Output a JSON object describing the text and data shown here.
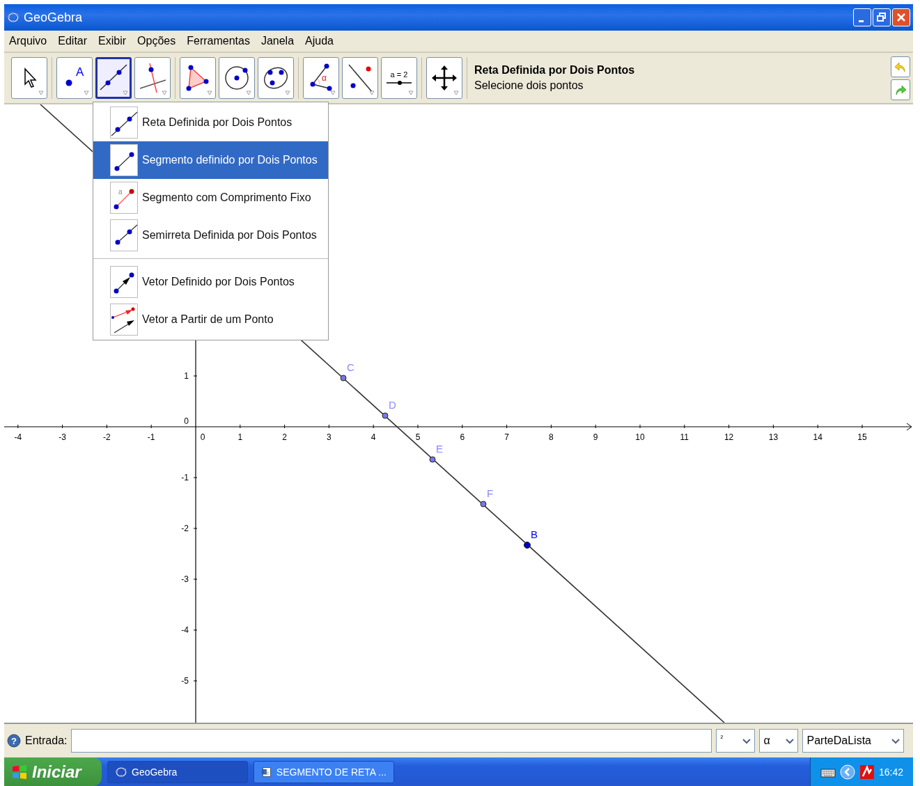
{
  "window": {
    "title": "GeoGebra"
  },
  "menu_bar": [
    "Arquivo",
    "Editar",
    "Exibir",
    "Opções",
    "Ferramentas",
    "Janela",
    "Ajuda"
  ],
  "toolbar": {
    "groups": [
      [
        {
          "kind": "move",
          "selected": false
        }
      ],
      [
        {
          "kind": "point",
          "caption": "A",
          "selected": false
        },
        {
          "kind": "line",
          "selected": true
        },
        {
          "kind": "perpendicular",
          "selected": false
        }
      ],
      [
        {
          "kind": "polygon",
          "selected": false
        },
        {
          "kind": "circle",
          "selected": false
        },
        {
          "kind": "conic",
          "selected": false
        }
      ],
      [
        {
          "kind": "angle",
          "caption": "α",
          "selected": false
        },
        {
          "kind": "reflect",
          "selected": false
        },
        {
          "kind": "slider",
          "caption": "a = 2",
          "selected": false
        }
      ],
      [
        {
          "kind": "move-view",
          "selected": false
        }
      ]
    ],
    "tool_title": "Reta Definida por Dois Pontos",
    "tool_hint": "Selecione dois pontos"
  },
  "tool_menu": {
    "sections": [
      [
        {
          "kind": "line",
          "label": "Reta Definida por Dois Pontos",
          "selected": false
        },
        {
          "kind": "segment",
          "label": "Segmento definido por Dois Pontos",
          "selected": true
        },
        {
          "kind": "segment-fixed",
          "caption": "a",
          "label": "Segmento com Comprimento Fixo",
          "selected": false
        },
        {
          "kind": "ray",
          "label": "Semirreta Definida por Dois Pontos",
          "selected": false
        }
      ],
      [
        {
          "kind": "vector",
          "label": "Vetor Definido por Dois Pontos",
          "selected": false
        },
        {
          "kind": "vector-from-point",
          "label": "Vetor a Partir de um Ponto",
          "selected": false
        }
      ]
    ]
  },
  "graphics": {
    "x_ticks": [
      "-4",
      "-3",
      "-2",
      "-1",
      "0",
      "1",
      "2",
      "3",
      "4",
      "5",
      "6",
      "7",
      "8",
      "9",
      "10",
      "11",
      "12",
      "13",
      "14",
      "15"
    ],
    "y_ticks": [
      "1",
      "0",
      "-1",
      "-2",
      "-3",
      "-4",
      "-5"
    ],
    "points": [
      {
        "label": "C",
        "kind": "dependent"
      },
      {
        "label": "D",
        "kind": "dependent"
      },
      {
        "label": "E",
        "kind": "dependent"
      },
      {
        "label": "F",
        "kind": "dependent"
      },
      {
        "label": "B",
        "kind": "free"
      }
    ]
  },
  "input_bar": {
    "help": "?",
    "label": "Entrada:",
    "dropdowns": [
      "²",
      "α",
      "ParteDaLista"
    ]
  },
  "taskbar": {
    "start": "Iniciar",
    "tasks": [
      {
        "label": "GeoGebra",
        "kind": "app",
        "selected": true
      },
      {
        "label": "SEGMENTO DE RETA ...",
        "kind": "document",
        "selected": false
      }
    ],
    "clock": "16:42"
  }
}
